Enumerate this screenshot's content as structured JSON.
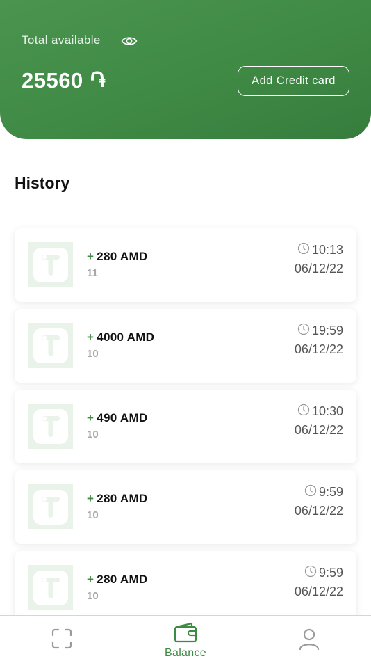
{
  "header": {
    "total_label": "Total available",
    "balance_amount": "25560",
    "currency_symbol": "֏",
    "add_card_label": "Add Credit card",
    "colors": {
      "primary": "#3f8a45",
      "text": "#ffffff"
    }
  },
  "history": {
    "title": "History",
    "items": [
      {
        "sign": "+",
        "amount": "280 AMD",
        "id": "11",
        "time": "10:13",
        "date": "06/12/22"
      },
      {
        "sign": "+",
        "amount": "4000 AMD",
        "id": "10",
        "time": "19:59",
        "date": "06/12/22"
      },
      {
        "sign": "+",
        "amount": "490 AMD",
        "id": "10",
        "time": "10:30",
        "date": "06/12/22"
      },
      {
        "sign": "+",
        "amount": "280 AMD",
        "id": "10",
        "time": "9:59",
        "date": "06/12/22"
      },
      {
        "sign": "+",
        "amount": "280 AMD",
        "id": "10",
        "time": "9:59",
        "date": "06/12/22"
      }
    ]
  },
  "nav": {
    "scan_icon": "scan-frame-icon",
    "balance_label": "Balance",
    "balance_icon": "wallet-icon",
    "profile_icon": "user-icon",
    "active_color": "#3d8a43",
    "inactive_color": "#9a9a9a"
  }
}
